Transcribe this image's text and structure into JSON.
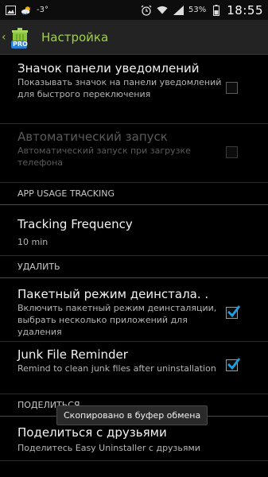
{
  "status_bar": {
    "temperature": "-3°",
    "battery_percent": "53%",
    "time": "18:55",
    "icons": [
      "image-icon",
      "weather-icon",
      "alarm-icon",
      "wifi-icon",
      "signal-icon",
      "battery-icon"
    ]
  },
  "action_bar": {
    "title": "Настройка",
    "logo_badge": "PRO"
  },
  "preferences": [
    {
      "title": "Значок панели уведомлений",
      "summary": "Показывать значок на панели уведомлений для быстрого переключения",
      "checked": false,
      "enabled": true
    },
    {
      "title": "Автоматический запуск",
      "summary": "Автоматический запуск при загрузке телефона",
      "checked": false,
      "enabled": false
    }
  ],
  "sections": {
    "app_usage": "APP USAGE TRACKING",
    "delete": "УДАЛИТЬ",
    "share": "ПОДЕЛИТЬСЯ"
  },
  "tracking": {
    "title": "Tracking Frequency",
    "value": "10 min"
  },
  "delete_prefs": [
    {
      "title": "Пакетный режим деинстала. .",
      "summary": "Включить пакетный режим деинсталяции, выбрать несколько приложений для удаления",
      "checked": true
    },
    {
      "title": "Junk File Reminder",
      "summary": "Remind to clean junk files after uninstallation",
      "checked": true
    }
  ],
  "share_pref": {
    "title": "Поделиться с друзьями",
    "summary": "Поделитесь Easy Uninstaller с друзьями"
  },
  "toast": "Скопировано в буфер обмена",
  "colors": {
    "accent": "#9fd246",
    "check": "#1e9fe0"
  }
}
